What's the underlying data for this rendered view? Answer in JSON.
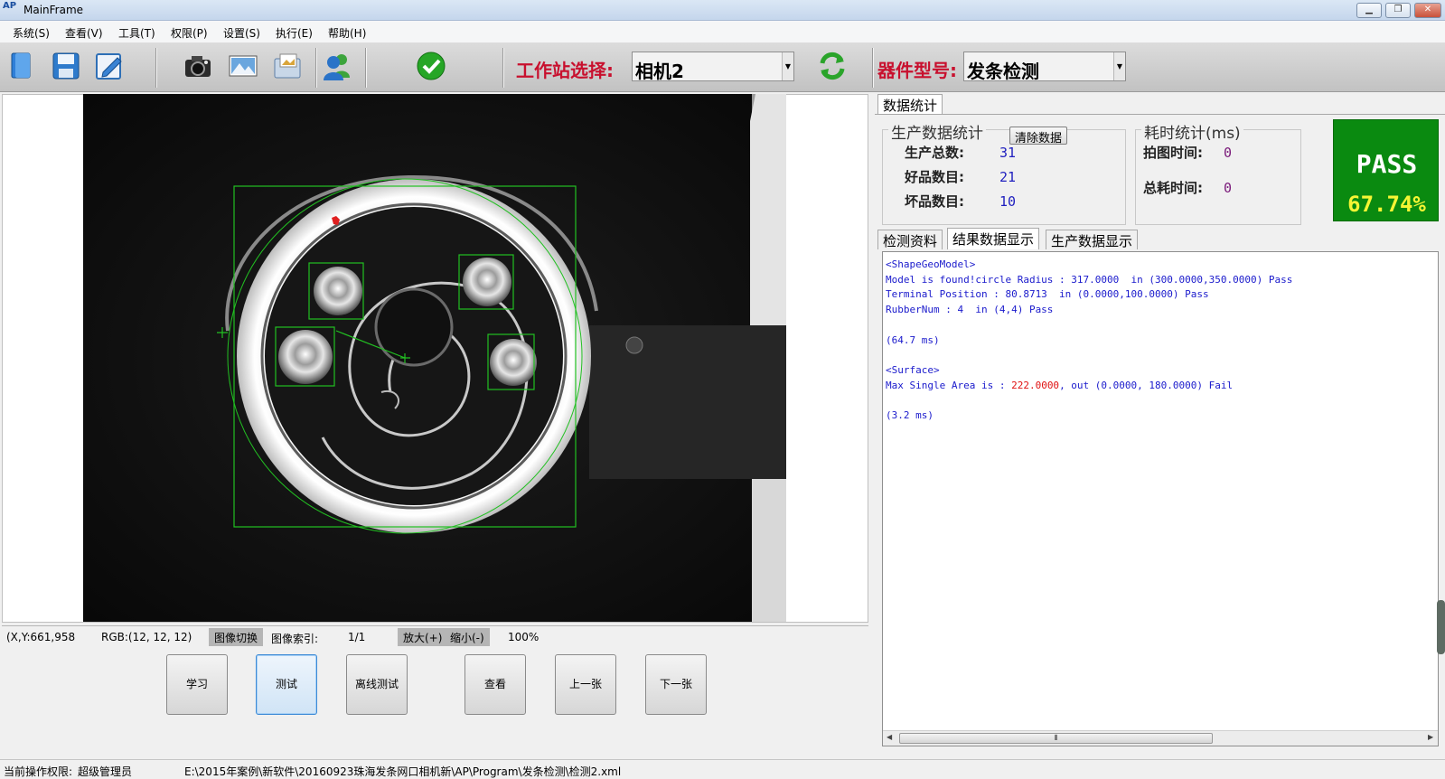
{
  "window": {
    "title": "MainFrame",
    "logo_text": "AP"
  },
  "menu": [
    "系统(S)",
    "查看(V)",
    "工具(T)",
    "权限(P)",
    "设置(S)",
    "执行(E)",
    "帮助(H)"
  ],
  "toolbar": {
    "icons": [
      "new-file-icon",
      "save-icon",
      "edit-icon",
      "camera-icon",
      "image-icon",
      "image-folder-icon",
      "users-icon",
      "check-icon",
      "refresh-icon"
    ],
    "station_label": "工作站选择:",
    "station_value": "相机2",
    "part_label": "器件型号:",
    "part_value": "发条检测"
  },
  "image_status": {
    "coords": "(X,Y:661,958",
    "rgb": "RGB:(12, 12, 12)",
    "switch_btn": "图像切换",
    "index_label": "图像索引:",
    "index_value": "1/1",
    "zoom_in": "放大(+)",
    "zoom_out": "缩小(-)",
    "zoom_level": "100%"
  },
  "actions": [
    "学习",
    "测试",
    "离线测试",
    "查看",
    "上一张",
    "下一张"
  ],
  "stats_tab": "数据统计",
  "production": {
    "title": "生产数据统计",
    "clear_btn": "清除数据",
    "total_label": "生产总数:",
    "total": "31",
    "good_label": "好品数目:",
    "good": "21",
    "bad_label": "坏品数目:",
    "bad": "10"
  },
  "timing": {
    "title": "耗时统计(ms)",
    "capture_label": "拍图时间:",
    "capture": "0",
    "total_label": "总耗时间:",
    "total": "0"
  },
  "result": {
    "status": "PASS",
    "rate": "67.74%"
  },
  "result_tabs": [
    "检测资料",
    "结果数据显示",
    "生产数据显示"
  ],
  "result_lines": {
    "l1": "<ShapeGeoModel>",
    "l2": "Model is found!circle Radius : 317.0000  in (300.0000,350.0000) Pass",
    "l3": "Terminal Position : 80.8713  in (0.0000,100.0000) Pass",
    "l4": "RubberNum : 4  in (4,4) Pass",
    "l5": "(64.7 ms)",
    "l6": "<Surface>",
    "l7a": "Max Single Area is : ",
    "l7b": "222.0000",
    "l7c": ", out (0.0000, 180.0000) Fail",
    "l8": "(3.2 ms)"
  },
  "statusbar": {
    "perm_label": "当前操作权限:",
    "perm_value": "超级管理员",
    "path": "E:\\2015年案例\\新软件\\20160923珠海发条网口相机新\\AP\\Program\\发条检测\\检测2.xml"
  },
  "colors": {
    "pass_bg": "#0a8a10",
    "label_red": "#c8102e",
    "overlay_green": "#22c022"
  }
}
